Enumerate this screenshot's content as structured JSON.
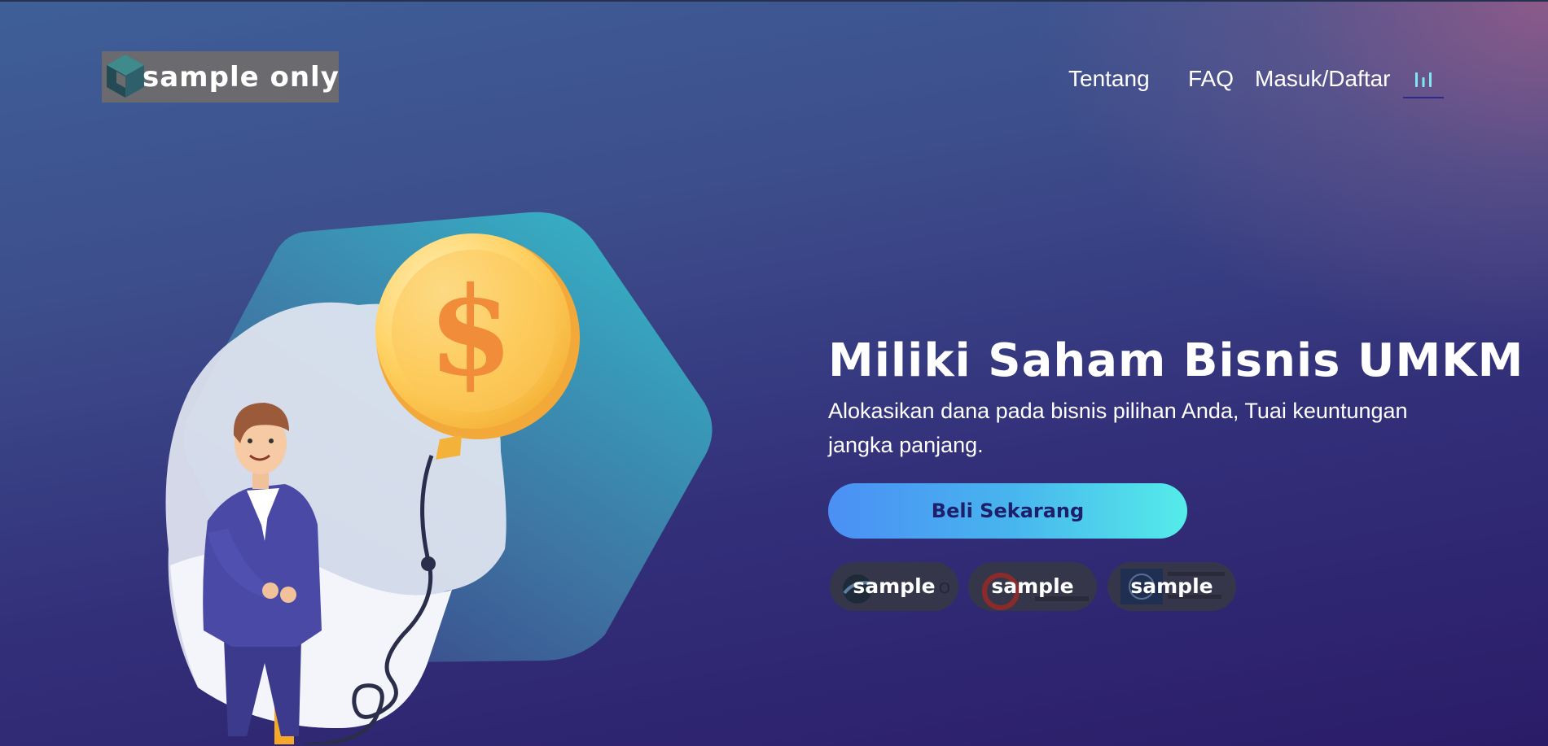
{
  "header": {
    "logo_text": "sample only",
    "nav": [
      {
        "label": "Tentang"
      },
      {
        "label": "FAQ"
      },
      {
        "label": "Masuk/Daftar"
      }
    ],
    "menu_icon": "bar-chart-icon"
  },
  "hero": {
    "title": "Miliki Saham Bisnis UMKM",
    "subtitle": "Alokasikan dana pada bisnis pilihan Anda, Tuai keuntungan jangka panjang.",
    "cta_label": "Beli Sekarang",
    "illustration_icon": "man-pumping-coin-balloon-illustration"
  },
  "badges": [
    {
      "label": "sample",
      "icon": "circle-logo-icon"
    },
    {
      "label": "sample",
      "icon": "ojk-logo-icon"
    },
    {
      "label": "sample",
      "icon": "iso-logo-icon"
    }
  ],
  "colors": {
    "cta_start": "#4b8ff5",
    "cta_end": "#54ece9",
    "cta_text": "#1d1f6a",
    "bg_top": "#3e5f98",
    "bg_bottom": "#2b1c68",
    "accent_pink": "#9a5c88"
  }
}
